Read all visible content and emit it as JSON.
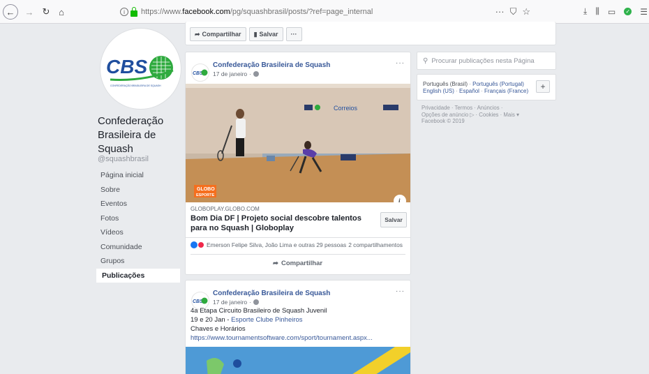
{
  "browser": {
    "url_prefix": "https://www.",
    "url_domain": "facebook.com",
    "url_path": "/pg/squashbrasil/posts/?ref=page_internal",
    "icons": [
      "back-icon",
      "forward-icon",
      "reload-icon",
      "home-icon",
      "info-icon",
      "lock-icon",
      "page-actions-icon",
      "pocket-icon",
      "bookmark-star-icon",
      "downloads-icon",
      "library-icon",
      "sidebar-icon",
      "extension-icon",
      "menu-icon"
    ]
  },
  "page": {
    "name": "Confederação Brasileira de Squash",
    "handle": "@squashbrasil",
    "logo_text": "CBS",
    "logo_subtext": "CONFEDERAÇÃO BRASILEIRA DE SQUASH"
  },
  "nav": [
    {
      "label": "Página inicial"
    },
    {
      "label": "Sobre"
    },
    {
      "label": "Eventos"
    },
    {
      "label": "Fotos"
    },
    {
      "label": "Vídeos"
    },
    {
      "label": "Comunidade"
    },
    {
      "label": "Grupos"
    },
    {
      "label": "Publicações",
      "active": true
    }
  ],
  "top_actions": {
    "share_label": "Compartilhar",
    "save_label": "Salvar",
    "more_label": "···"
  },
  "post1": {
    "author": "Confederação Brasileira de Squash",
    "date": "17 de janeiro",
    "more": "···",
    "video_banner": "Correios",
    "video_badge_top": "GLOBO",
    "video_badge_bottom": "ESPORTE",
    "info_glyph": "i",
    "link_source": "GLOBOPLAY.GLOBO.COM",
    "link_title": "Bom Dia DF | Projeto social descobre talentos para no Squash | Globoplay",
    "save_label": "Salvar",
    "reactions_text": "Emerson Felipe Silva, João Lima e outras 29 pessoas",
    "shares_text": "2 compartilhamentos",
    "share_action": "Compartilhar"
  },
  "post2": {
    "author": "Confederação Brasileira de Squash",
    "date": "17 de janeiro",
    "more": "···",
    "line1": "4a Etapa Circuito Brasileiro de Squash Juvenil",
    "line2_prefix": "19 e 20 Jan - ",
    "line2_link": "Esporte Clube Pinheiros",
    "line3": "Chaves e Horários",
    "line4_link": "https://www.tournamentsoftware.com/sport/tournament.aspx..."
  },
  "sidebar": {
    "search_placeholder": "Procurar publicações nesta Página",
    "lang_current": "Português (Brasil)",
    "lang_options_line1": [
      "Português (Portugal)"
    ],
    "lang_options_line2": [
      "English (US)",
      "Español",
      "Français (France)"
    ],
    "add_label": "+",
    "footer_line1": "Privacidade · Termos · Anúncios ·",
    "footer_line2": "Opções de anúncio ▷ · Cookies · Mais ▾",
    "footer_line3": "Facebook © 2019"
  },
  "colors": {
    "fb_blue": "#385898",
    "background": "#e9ebee",
    "cbs_green": "#2eaa3e",
    "cbs_blue": "#1f4e9e"
  }
}
